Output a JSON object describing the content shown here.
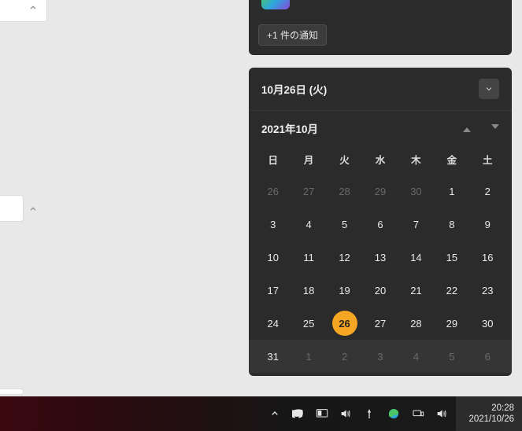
{
  "notification": {
    "more_label": "+1 件の通知"
  },
  "calendar": {
    "header_date": "10月26日 (火)",
    "month_label": "2021年10月",
    "dow": [
      "日",
      "月",
      "火",
      "水",
      "木",
      "金",
      "土"
    ],
    "weeks": [
      [
        {
          "n": "26",
          "out": true
        },
        {
          "n": "27",
          "out": true
        },
        {
          "n": "28",
          "out": true
        },
        {
          "n": "29",
          "out": true
        },
        {
          "n": "30",
          "out": true
        },
        {
          "n": "1"
        },
        {
          "n": "2"
        }
      ],
      [
        {
          "n": "3"
        },
        {
          "n": "4"
        },
        {
          "n": "5"
        },
        {
          "n": "6"
        },
        {
          "n": "7"
        },
        {
          "n": "8"
        },
        {
          "n": "9"
        }
      ],
      [
        {
          "n": "10"
        },
        {
          "n": "11"
        },
        {
          "n": "12"
        },
        {
          "n": "13"
        },
        {
          "n": "14"
        },
        {
          "n": "15"
        },
        {
          "n": "16"
        }
      ],
      [
        {
          "n": "17"
        },
        {
          "n": "18"
        },
        {
          "n": "19"
        },
        {
          "n": "20"
        },
        {
          "n": "21"
        },
        {
          "n": "22"
        },
        {
          "n": "23"
        }
      ],
      [
        {
          "n": "24"
        },
        {
          "n": "25"
        },
        {
          "n": "26",
          "today": true
        },
        {
          "n": "27"
        },
        {
          "n": "28"
        },
        {
          "n": "29"
        },
        {
          "n": "30"
        }
      ],
      [
        {
          "n": "31"
        },
        {
          "n": "1",
          "out": true
        },
        {
          "n": "2",
          "out": true
        },
        {
          "n": "3",
          "out": true
        },
        {
          "n": "4",
          "out": true
        },
        {
          "n": "5",
          "out": true
        },
        {
          "n": "6",
          "out": true
        }
      ]
    ]
  },
  "taskbar": {
    "time": "20:28",
    "date": "2021/10/26"
  }
}
